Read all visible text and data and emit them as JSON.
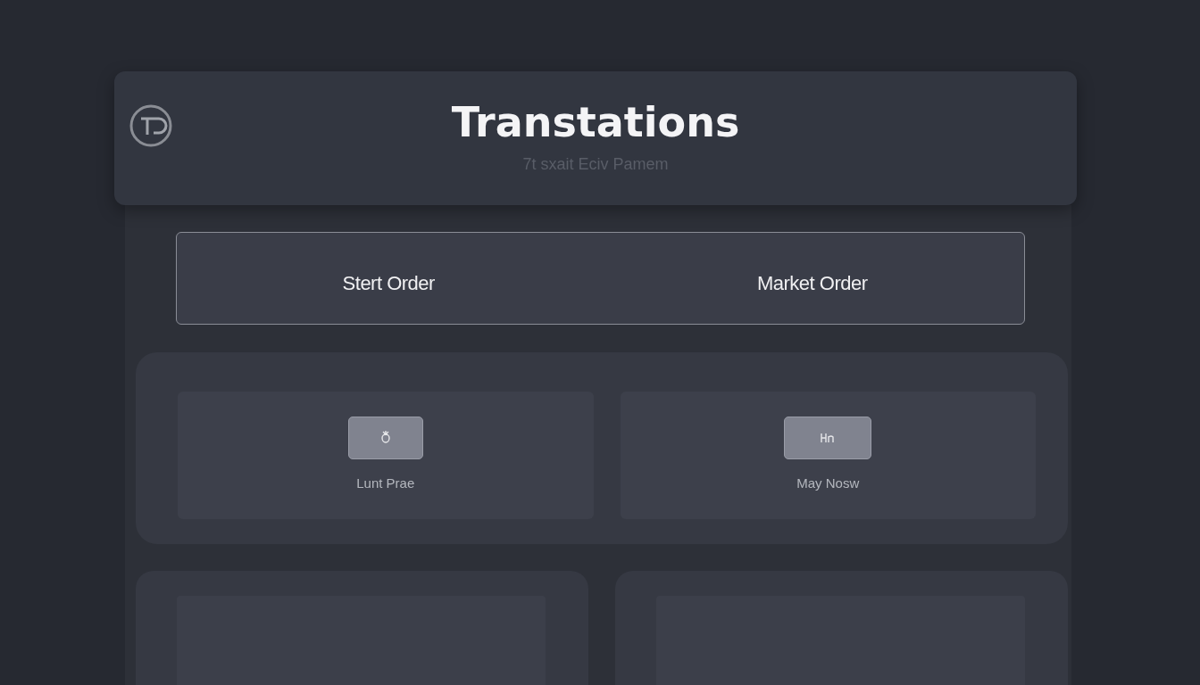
{
  "header": {
    "title": "Transtations",
    "subtitle": "7t sxait Eciv Pamem"
  },
  "order_types": [
    {
      "label": "Stert Order"
    },
    {
      "label": "Market Order"
    }
  ],
  "order_cards": [
    {
      "label": "Lunt Prae"
    },
    {
      "label": "May Nosw"
    }
  ],
  "lower_cards": [
    {
      "kind": "empty"
    },
    {
      "kind": "empty"
    }
  ]
}
